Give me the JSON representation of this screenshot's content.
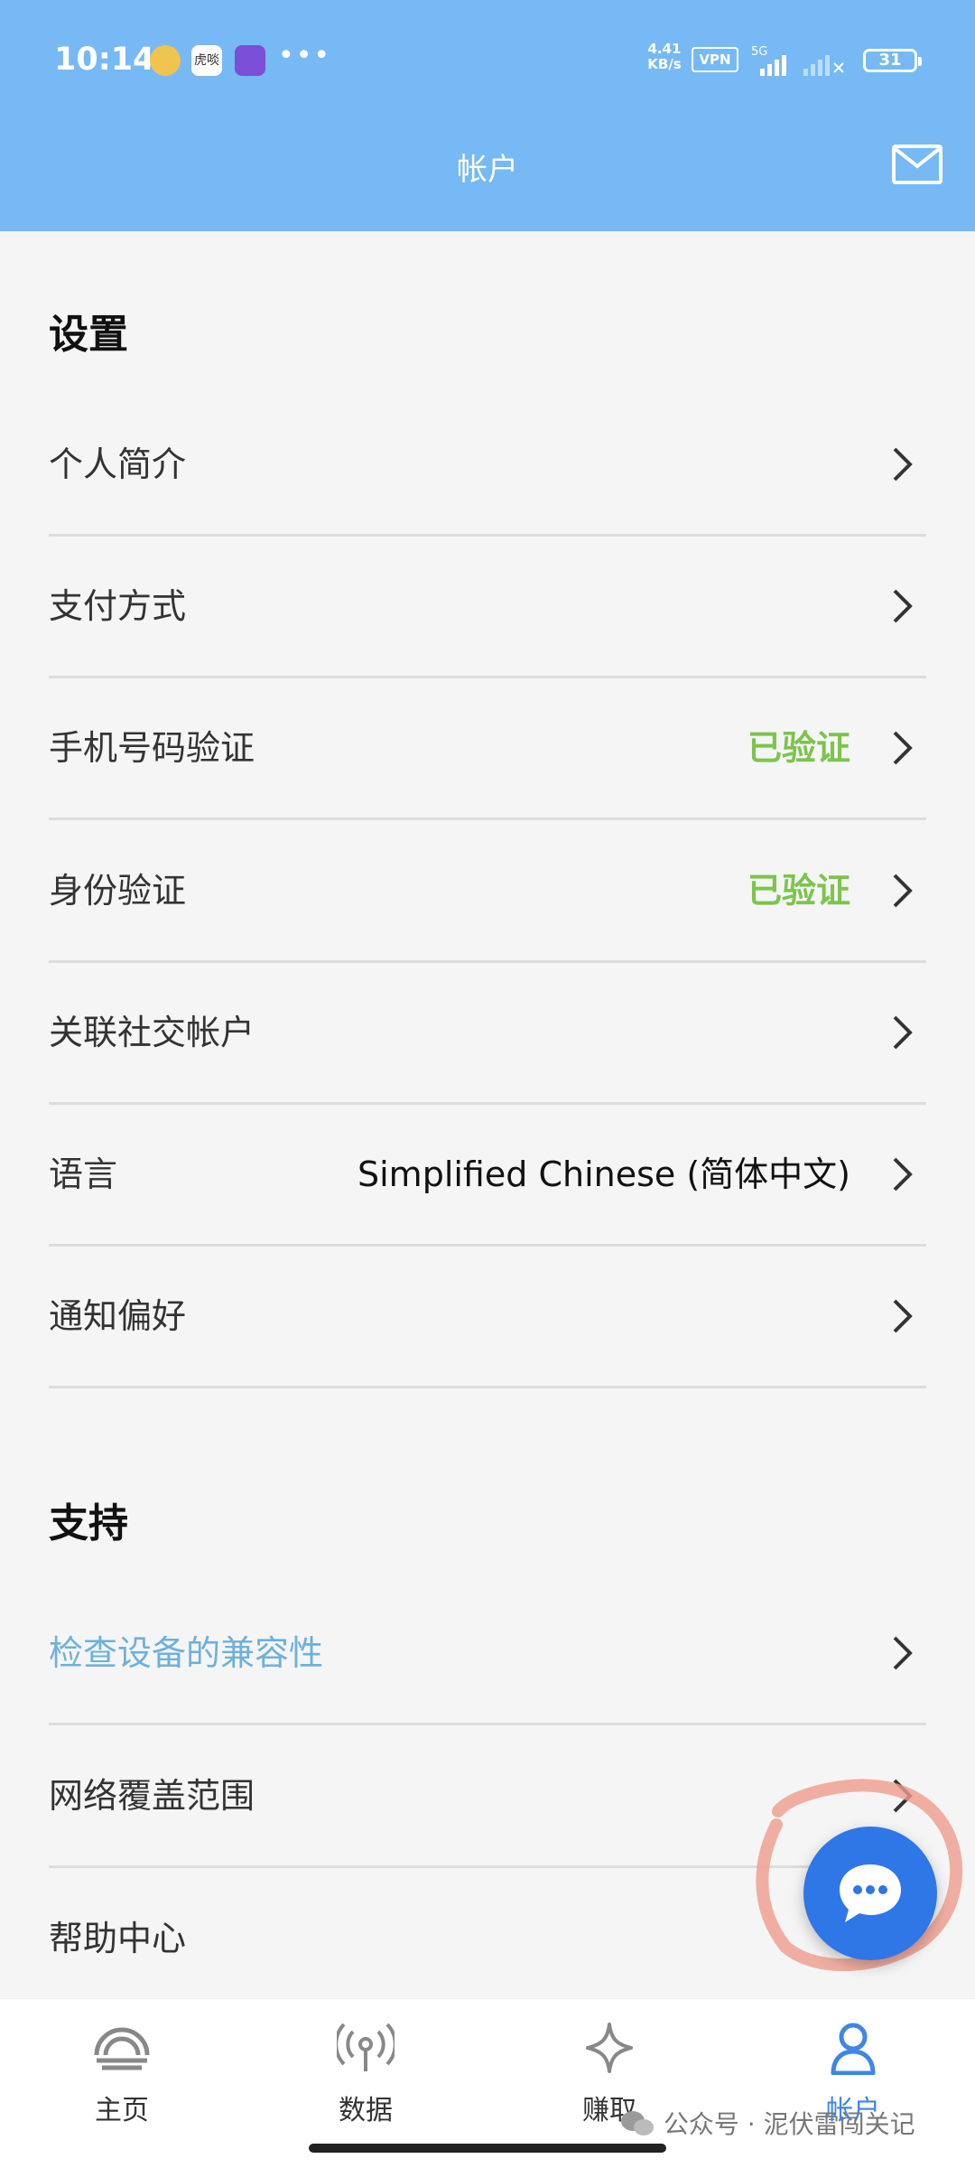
{
  "status_bar": {
    "time": "10:14",
    "app_icons": [
      "app-icon",
      "虎啖",
      "app-icon"
    ],
    "more": "•••",
    "speed": "4.41 KB/s",
    "vpn": "VPN",
    "network": "5G",
    "battery": "31"
  },
  "header": {
    "title": "帐户",
    "mail_icon": "mail-icon",
    "background": "#77b9f5"
  },
  "settings": {
    "title": "设置",
    "items": [
      {
        "label": "个人简介",
        "value": ""
      },
      {
        "label": "支付方式",
        "value": ""
      },
      {
        "label": "手机号码验证",
        "value": "已验证"
      },
      {
        "label": "身份验证",
        "value": "已验证"
      },
      {
        "label": "关联社交帐户",
        "value": ""
      },
      {
        "label": "语言",
        "value": "Simplified Chinese (简体中文)"
      },
      {
        "label": "通知偏好",
        "value": ""
      }
    ]
  },
  "support": {
    "title": "支持",
    "items": [
      {
        "label": "检查设备的兼容性"
      },
      {
        "label": "网络覆盖范围"
      },
      {
        "label": "帮助中心"
      }
    ]
  },
  "chat_button": {
    "icon": "chat-bubble-icon"
  },
  "bottom_nav": {
    "items": [
      {
        "label": "主页",
        "icon": "home-icon"
      },
      {
        "label": "数据",
        "icon": "signal-icon"
      },
      {
        "label": "赚取",
        "icon": "sparkle-icon"
      },
      {
        "label": "帐户",
        "icon": "user-icon",
        "active": true
      }
    ]
  },
  "watermark": "公众号 · 泥伏雷闯关记",
  "colors": {
    "header": "#77b9f5",
    "verified": "#7cc44d",
    "link": "#6fb0dc",
    "active_nav": "#3e86e8",
    "chat_button": "#2f76e6"
  }
}
